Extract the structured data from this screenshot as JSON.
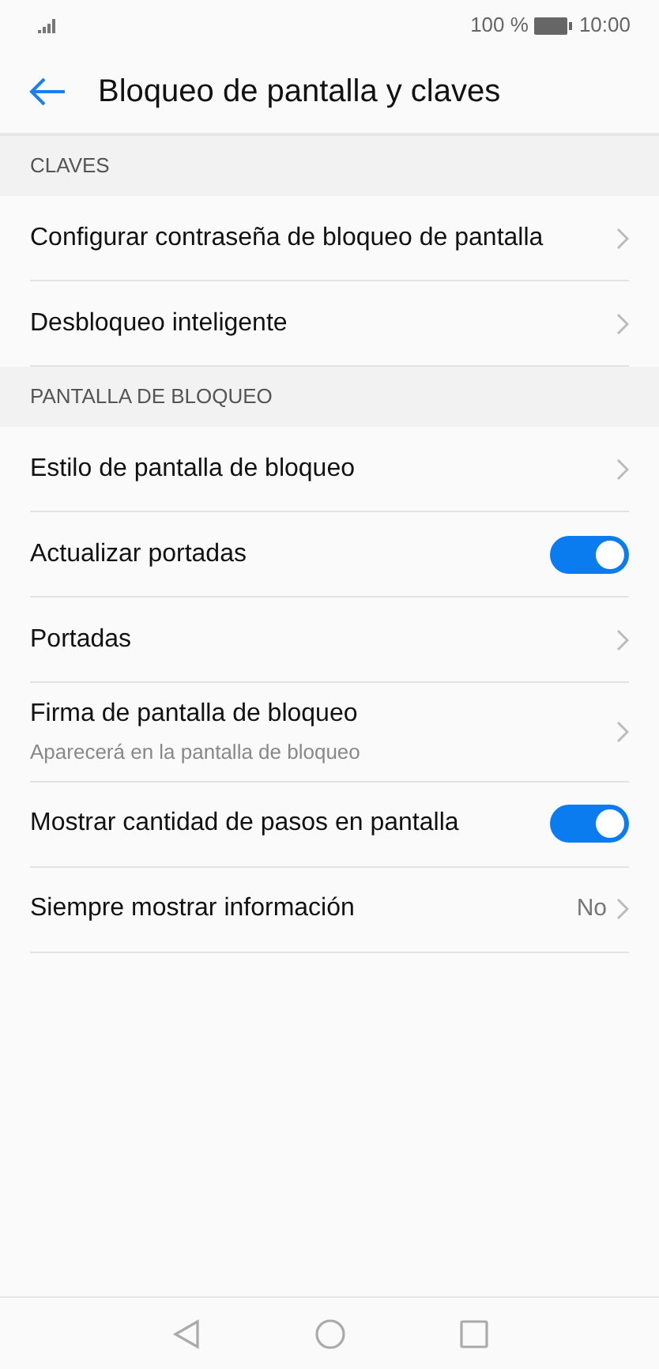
{
  "status_bar": {
    "battery": "100 %",
    "time": "10:00"
  },
  "header": {
    "title": "Bloqueo de pantalla y claves"
  },
  "sections": [
    {
      "title": "CLAVES",
      "items": [
        {
          "kind": "link",
          "label": "Configurar contraseña de bloqueo de pantalla"
        },
        {
          "kind": "link",
          "label": "Desbloqueo inteligente"
        }
      ]
    },
    {
      "title": "PANTALLA DE BLOQUEO",
      "items": [
        {
          "kind": "link",
          "label": "Estilo de pantalla de bloqueo"
        },
        {
          "kind": "toggle",
          "label": "Actualizar portadas",
          "on": true
        },
        {
          "kind": "link",
          "label": "Portadas"
        },
        {
          "kind": "link",
          "label": "Firma de pantalla de bloqueo",
          "subtitle": "Aparecerá en la pantalla de bloqueo"
        },
        {
          "kind": "toggle",
          "label": "Mostrar cantidad de pasos en pantalla",
          "on": true
        },
        {
          "kind": "value",
          "label": "Siempre mostrar información",
          "value": "No"
        }
      ]
    }
  ]
}
